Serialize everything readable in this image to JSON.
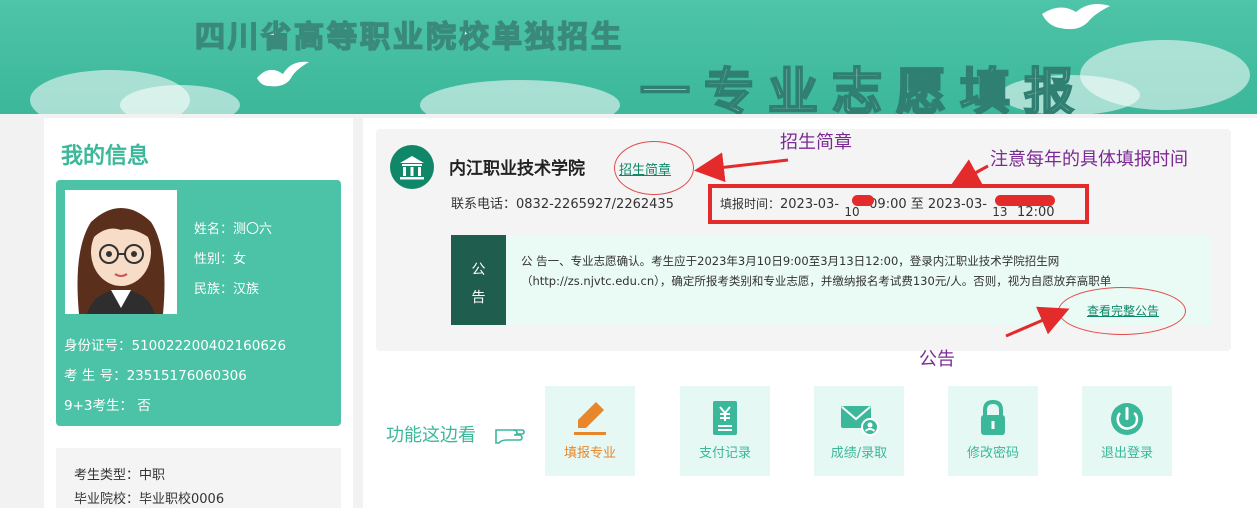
{
  "banner": {
    "title": "四川省高等职业院校单独招生",
    "subtitle": "一专业志愿填报"
  },
  "profile": {
    "heading": "我的信息",
    "name": "姓名：测〇六",
    "gender": "性别：女",
    "ethnicity": "民族：汉族",
    "id_number": "身份证号：510022200402160626",
    "exam_number": "考 生 号：23515176060306",
    "nine_plus_three": "9+3考生： 否"
  },
  "candidate": {
    "type": "考生类型：中职",
    "school": "毕业院校：毕业职校0006"
  },
  "school": {
    "name": "内江职业技术学院",
    "brochure_link": "招生简章",
    "phone": "联系电话：0832-2265927/2262435",
    "fill_time_label": "填报时间：",
    "fill_time_start": "2023-03-",
    "fill_time_start_day": "10",
    "fill_time_start_clock": " 09:00",
    "fill_time_sep": " 至 ",
    "fill_time_end": "2023-03-",
    "fill_time_end_day": "13",
    "fill_time_end_clock": " 12:00"
  },
  "notice": {
    "tag_1": "公",
    "tag_2": "告",
    "text": "公 告一、专业志愿确认。考生应于2023年3月10日9:00至3月13日12:00，登录内江职业技术学院招生网（http://zs.njvtc.edu.cn），确定所报考类别和专业志愿，并缴纳报名考试费130元/人。否则，视为自愿放弃高职单",
    "more_link": "查看完整公告"
  },
  "functions": {
    "label": "功能这边看",
    "items": [
      {
        "label": "填报专业",
        "icon": "pencil-icon"
      },
      {
        "label": "支付记录",
        "icon": "payment-record-icon"
      },
      {
        "label": "成绩/录取",
        "icon": "mail-user-icon"
      },
      {
        "label": "修改密码",
        "icon": "lock-icon"
      },
      {
        "label": "退出登录",
        "icon": "power-icon"
      }
    ]
  },
  "annotations": {
    "brochure": "招生简章",
    "time_note": "注意每年的具体填报时间",
    "notice": "公告"
  },
  "colors": {
    "brand_green": "#3bb79a",
    "dark_green": "#0f8768",
    "notice_tag": "#1f5e4e",
    "active_orange": "#e8862c",
    "annotation_red": "#e32b2b",
    "annotation_purple": "#7b2a94"
  }
}
